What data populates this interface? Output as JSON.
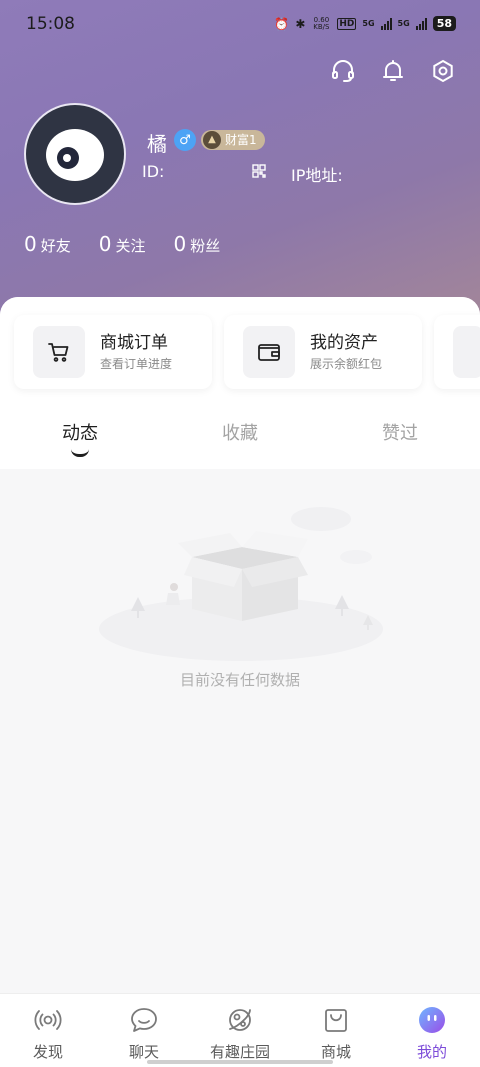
{
  "status_bar": {
    "time": "15:08",
    "net_speed_top": "0.60",
    "net_speed_bottom": "KB/S",
    "hd_label": "HD",
    "sim1_label": "5G",
    "sim2_label": "5G",
    "battery": "58"
  },
  "header": {
    "icons": [
      "headset-icon",
      "bell-icon",
      "settings-icon"
    ]
  },
  "profile": {
    "username": "橘",
    "gender_symbol": "♂",
    "wealth_badge": "财富1",
    "id_label": "ID:",
    "ip_label": "IP地址:",
    "stats": [
      {
        "num": "0",
        "label": "好友"
      },
      {
        "num": "0",
        "label": "关注"
      },
      {
        "num": "0",
        "label": "粉丝"
      }
    ]
  },
  "shortcuts": [
    {
      "title": "商城订单",
      "sub": "查看订单进度",
      "icon": "cart-icon"
    },
    {
      "title": "我的资产",
      "sub": "展示余额红包",
      "icon": "wallet-icon"
    }
  ],
  "tabs": [
    {
      "label": "动态",
      "active": true
    },
    {
      "label": "收藏",
      "active": false
    },
    {
      "label": "赞过",
      "active": false
    }
  ],
  "empty_state": {
    "text": "目前没有任何数据"
  },
  "bottom_nav": [
    {
      "label": "发现",
      "icon": "broadcast-icon",
      "active": false
    },
    {
      "label": "聊天",
      "icon": "chat-bubble-icon",
      "active": false
    },
    {
      "label": "有趣庄园",
      "icon": "planet-icon",
      "active": false
    },
    {
      "label": "商城",
      "icon": "shopping-bag-icon",
      "active": false
    },
    {
      "label": "我的",
      "icon": "profile-face-icon",
      "active": true
    }
  ],
  "colors": {
    "accent": "#7d4cd9",
    "header_gradient_start": "#8f7bb9",
    "header_gradient_end": "#a48798"
  }
}
